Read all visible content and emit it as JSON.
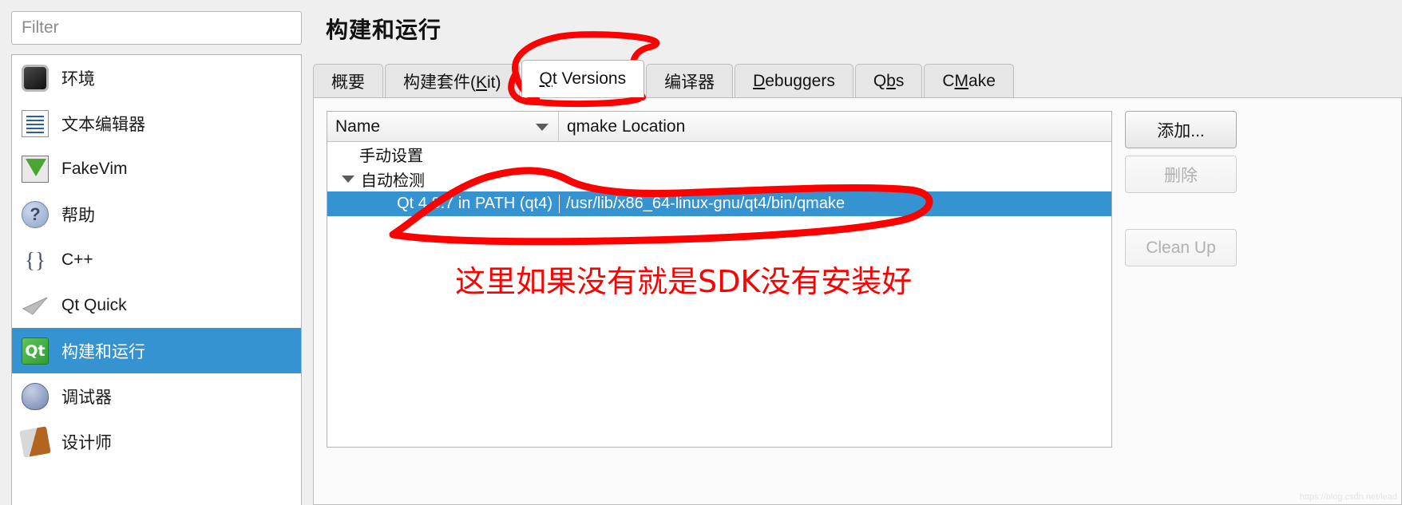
{
  "filter": {
    "placeholder": "Filter",
    "value": ""
  },
  "sidebar": {
    "items": [
      {
        "label": "环境",
        "icon": "monitor-icon"
      },
      {
        "label": "文本编辑器",
        "icon": "text-editor-icon"
      },
      {
        "label": "FakeVim",
        "icon": "fakevim-icon"
      },
      {
        "label": "帮助",
        "icon": "help-question-icon"
      },
      {
        "label": "C++",
        "icon": "braces-icon"
      },
      {
        "label": "Qt Quick",
        "icon": "paper-plane-icon"
      },
      {
        "label": "构建和运行",
        "icon": "qt-build-icon",
        "selected": true
      },
      {
        "label": "调试器",
        "icon": "bug-icon"
      },
      {
        "label": "设计师",
        "icon": "designer-pen-icon"
      }
    ]
  },
  "page": {
    "title": "构建和运行"
  },
  "tabs": [
    {
      "label": "概要",
      "active": false
    },
    {
      "label": "构建套件(Kit)",
      "active": false,
      "mnemonic": "K"
    },
    {
      "label": "Qt Versions",
      "active": true,
      "mnemonic": "Q"
    },
    {
      "label": "编译器",
      "active": false
    },
    {
      "label": "Debuggers",
      "active": false,
      "mnemonic": "D"
    },
    {
      "label": "Qbs",
      "active": false,
      "mnemonic": "b"
    },
    {
      "label": "CMake",
      "active": false,
      "mnemonic": "M"
    }
  ],
  "table": {
    "columns": [
      "Name",
      "qmake Location"
    ],
    "sort_column": "Name",
    "sort_direction": "descending",
    "rows": [
      {
        "name": "手动设置",
        "location": "",
        "level": 0,
        "expandable": false,
        "selected": false
      },
      {
        "name": "自动检测",
        "location": "",
        "level": 0,
        "expandable": true,
        "expanded": true,
        "selected": false
      },
      {
        "name": "Qt 4.8.7 in PATH (qt4)",
        "location": "/usr/lib/x86_64-linux-gnu/qt4/bin/qmake",
        "level": 1,
        "expandable": false,
        "selected": true
      }
    ]
  },
  "buttons": {
    "add": {
      "label": "添加...",
      "enabled": true
    },
    "delete": {
      "label": "删除",
      "enabled": false
    },
    "clean_up": {
      "label": "Clean Up",
      "enabled": false
    }
  },
  "annotation": {
    "note": "这里如果没有就是SDK没有安装好",
    "color": "#ff0000",
    "circled_tab": "Qt Versions",
    "circled_row": "Qt 4.8.7 in PATH (qt4)"
  },
  "watermark": {
    "text": "https://blog.csdn.net/lead"
  },
  "colors": {
    "selection": "#3593d2",
    "annotation_red": "#ff0000",
    "panel_bg": "#efefef",
    "content_bg": "#fbfbfb"
  }
}
